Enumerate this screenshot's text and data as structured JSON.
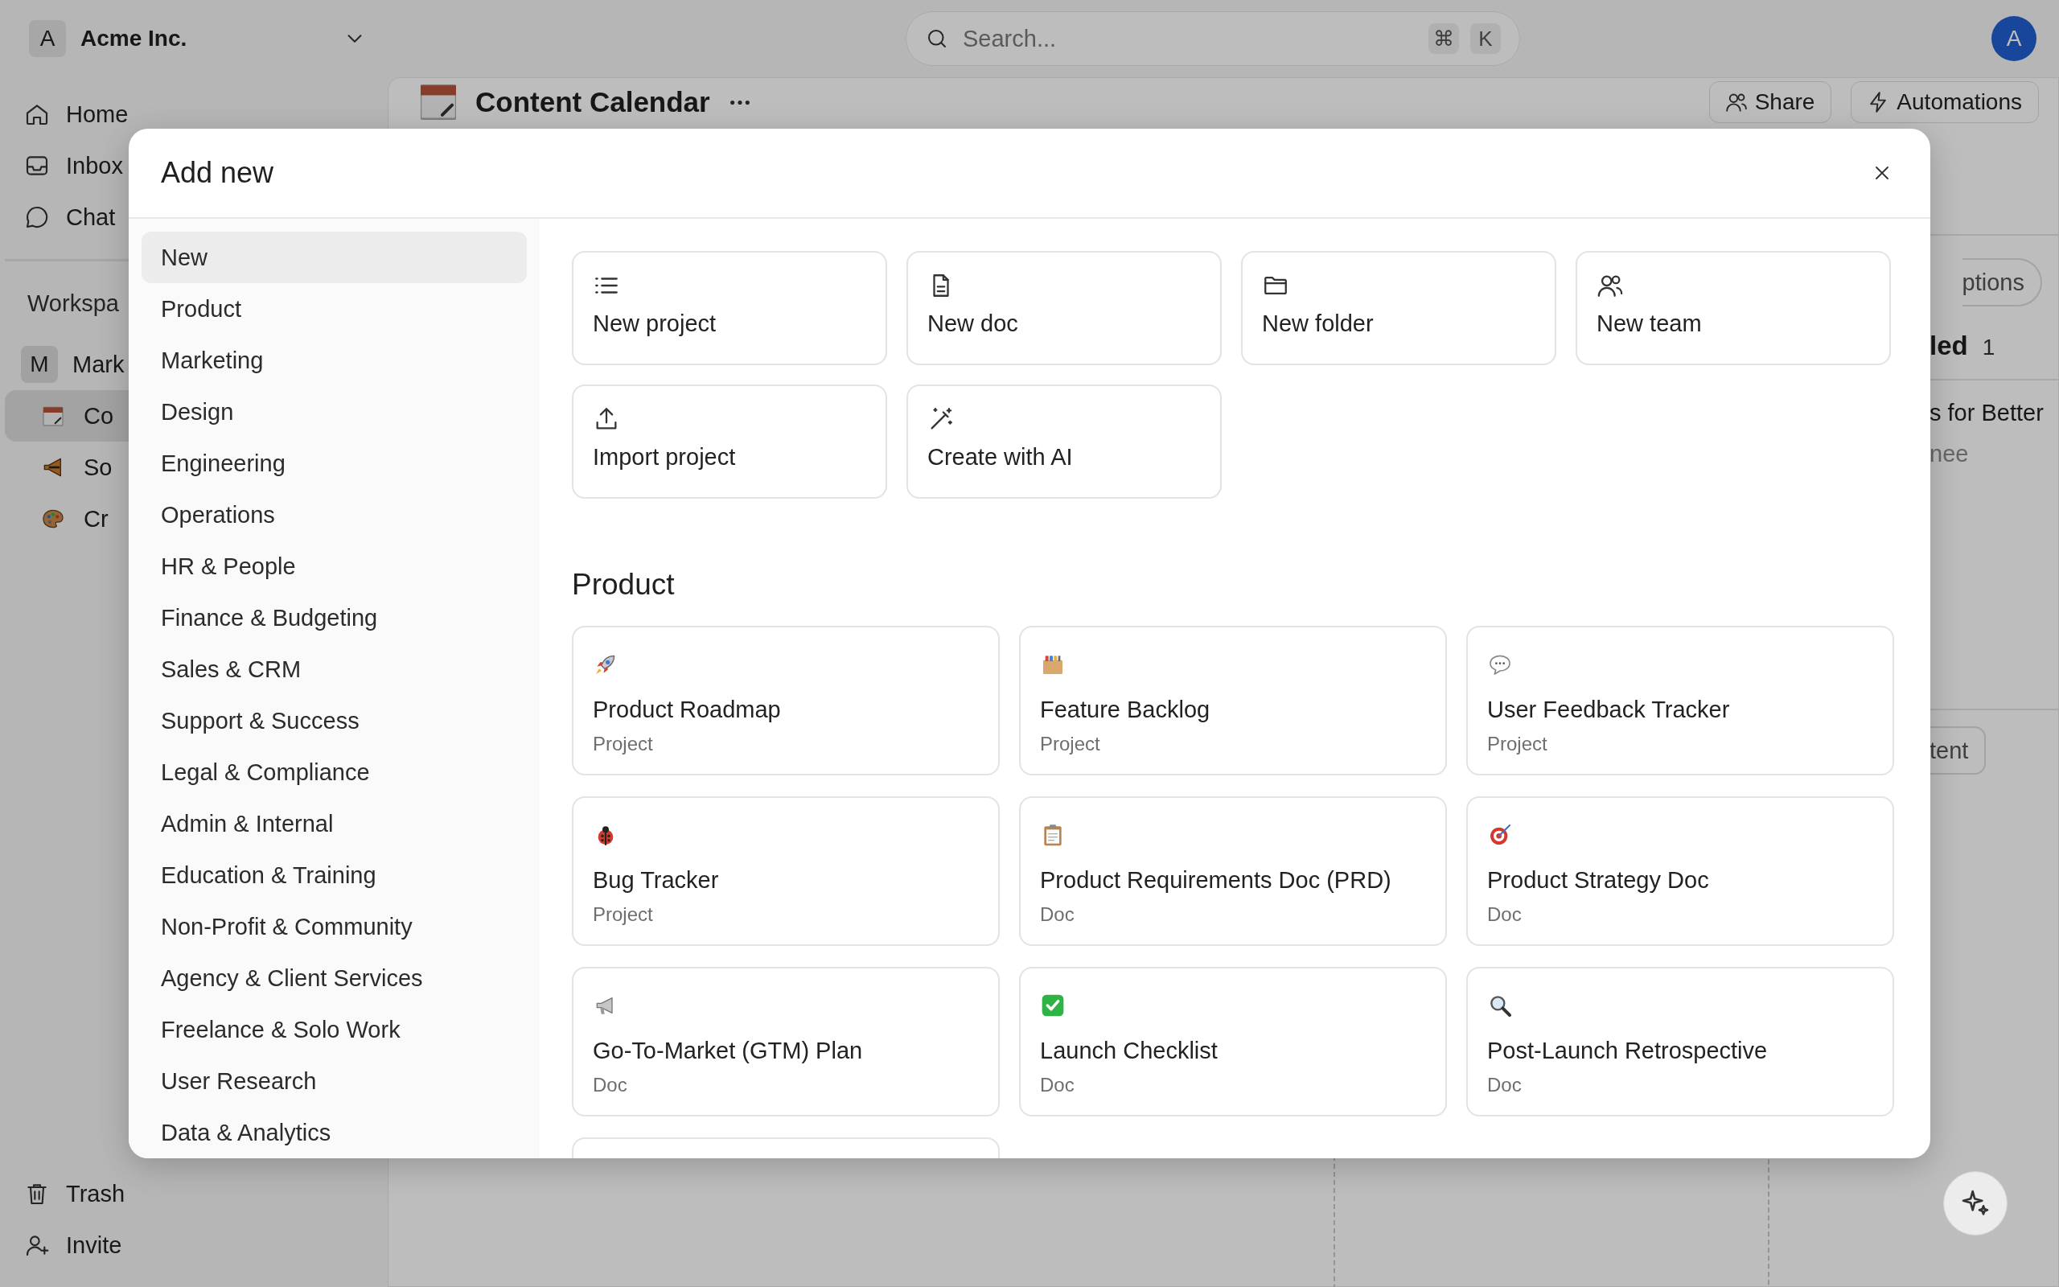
{
  "topbar": {
    "workspace_initial": "A",
    "workspace_name": "Acme Inc.",
    "search": {
      "placeholder": "Search...",
      "shortcut": [
        "⌘",
        "K"
      ]
    },
    "avatar": "A"
  },
  "sidebar": {
    "nav": [
      {
        "label": "Home"
      },
      {
        "label": "Inbox"
      },
      {
        "label": "Chat"
      }
    ],
    "section": "Workspa",
    "workspace": {
      "initial": "M",
      "name": "Mark"
    },
    "items": [
      {
        "label": "Co",
        "selected": true
      },
      {
        "label": "So",
        "selected": false
      },
      {
        "label": "Cr",
        "selected": false
      }
    ],
    "footer": [
      {
        "label": "Trash"
      },
      {
        "label": "Invite"
      }
    ]
  },
  "page": {
    "title": "Content Calendar",
    "actions": [
      "Share",
      "Automations"
    ],
    "options_button": "ptions",
    "group_title": "led",
    "group_count": "1",
    "item_title": "s for Better",
    "item_meta": "nee",
    "add_button": "tent"
  },
  "modal": {
    "title": "Add new",
    "categories": [
      {
        "label": "New",
        "selected": true
      },
      {
        "label": "Product",
        "selected": false
      },
      {
        "label": "Marketing",
        "selected": false
      },
      {
        "label": "Design",
        "selected": false
      },
      {
        "label": "Engineering",
        "selected": false
      },
      {
        "label": "Operations",
        "selected": false
      },
      {
        "label": "HR & People",
        "selected": false
      },
      {
        "label": "Finance & Budgeting",
        "selected": false
      },
      {
        "label": "Sales & CRM",
        "selected": false
      },
      {
        "label": "Support & Success",
        "selected": false
      },
      {
        "label": "Legal & Compliance",
        "selected": false
      },
      {
        "label": "Admin & Internal",
        "selected": false
      },
      {
        "label": "Education & Training",
        "selected": false
      },
      {
        "label": "Non-Profit & Community",
        "selected": false
      },
      {
        "label": "Agency & Client Services",
        "selected": false
      },
      {
        "label": "Freelance & Solo Work",
        "selected": false
      },
      {
        "label": "User Research",
        "selected": false
      },
      {
        "label": "Data & Analytics",
        "selected": false
      }
    ],
    "quick_actions": [
      {
        "label": "New project"
      },
      {
        "label": "New doc"
      },
      {
        "label": "New folder"
      },
      {
        "label": "New team"
      },
      {
        "label": "Import project"
      },
      {
        "label": "Create with AI"
      }
    ],
    "section_title": "Product",
    "templates": [
      {
        "name": "Product Roadmap",
        "type": "Project"
      },
      {
        "name": "Feature Backlog",
        "type": "Project"
      },
      {
        "name": "User Feedback Tracker",
        "type": "Project"
      },
      {
        "name": "Bug Tracker",
        "type": "Project"
      },
      {
        "name": "Product Requirements Doc (PRD)",
        "type": "Doc"
      },
      {
        "name": "Product Strategy Doc",
        "type": "Doc"
      },
      {
        "name": "Go-To-Market (GTM) Plan",
        "type": "Doc"
      },
      {
        "name": "Launch Checklist",
        "type": "Doc"
      },
      {
        "name": "Post-Launch Retrospective",
        "type": "Doc"
      }
    ]
  }
}
